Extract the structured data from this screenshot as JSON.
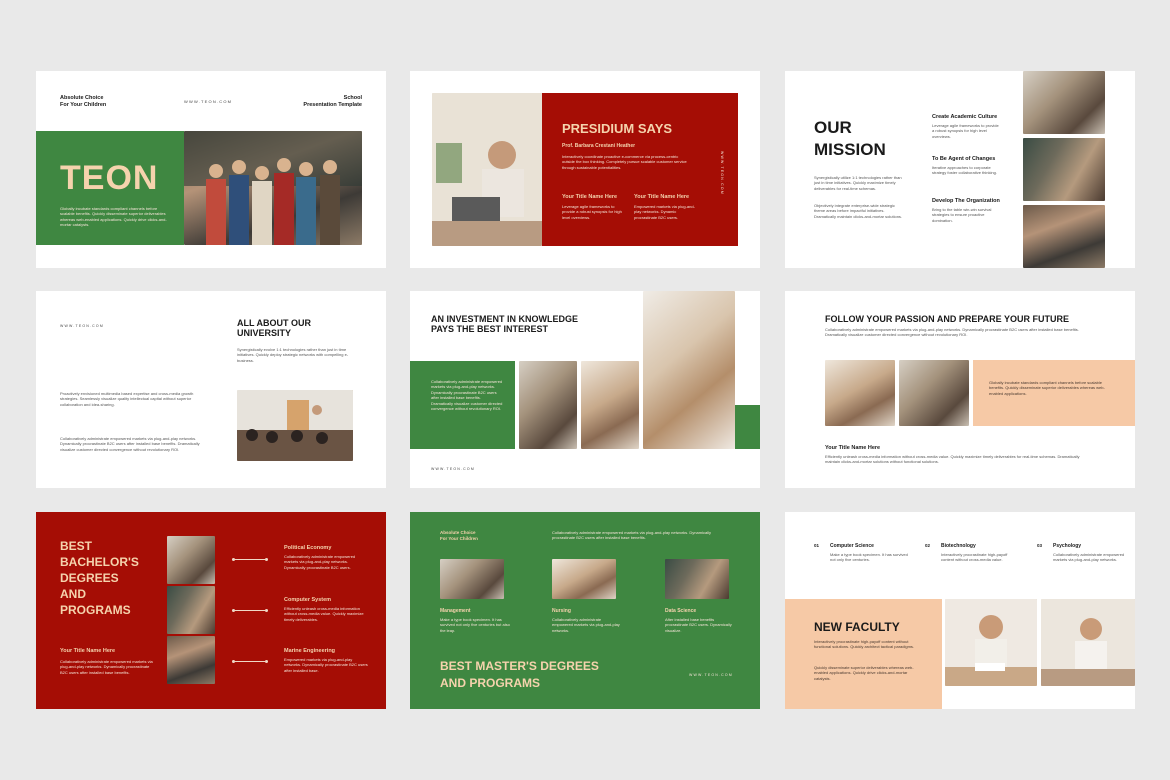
{
  "s1": {
    "top_left": [
      "Absolute Choice",
      "For Your Children"
    ],
    "web": "WWW.TEON.COM",
    "top_right": [
      "School",
      "Presentation Template"
    ],
    "title": "TEON",
    "desc": "Globally incubate standards compliant channels before scalable benefits. Quickly disseminate superior deliverables whereas web-enabled applications. Quickly drive clicks-and-mortar catalysts."
  },
  "s2": {
    "title": "PRESIDIUM SAYS",
    "author": "Prof. Barbara Crestani Heather",
    "quote": "Interactively coordinate proactive e-commerce via process-centric outside the box thinking. Completely pursue scalable customer service through sustainable potentialities.",
    "web_vertical": "WWW.TEON.COM",
    "col1_title": "Your Title Name Here",
    "col1_text": "Leverage agile frameworks to provide a robust synopsis for high level overviews.",
    "col2_title": "Your Title Name Here",
    "col2_text": "Empowered markets via plug-and-play networks. Dynamic procrastinate B2C users."
  },
  "s3": {
    "title": [
      "OUR",
      "MISSION"
    ],
    "p1": "Synergistically utilize 1:1 technologies rather than just in time initiatives. Quickly maximize timely deliverables for real-time schemas.",
    "p2": "Objectively integrate enterprise-wide strategic theme areas before impactful initiatives. Dramatically maintain clicks-and-mortar solutions.",
    "items": [
      {
        "title": "Create Academic Culture",
        "text": "Leverage agile frameworks to provide a robust synopsis for high level overviews."
      },
      {
        "title": "To Be Agent of Changes",
        "text": "Iterative approaches to corporate strategy foster collaborative thinking."
      },
      {
        "title": "Develop The Organization",
        "text": "Bring to the table win-win survival strategies to ensure proactive domination."
      }
    ]
  },
  "s4": {
    "web": "WWW.TEON.COM",
    "title": [
      "ALL ABOUT OUR",
      "UNIVERSITY"
    ],
    "p1": "Synergistically evolve 1:1 technologies rather than just in time initiatives. Quickly deploy strategic networks with compelling e-business.",
    "p2": "Proactively envisioned multimedia based expertise and cross-media growth strategies. Seamlessly visualize quality intellectual capital without superior collaboration and idea-sharing.",
    "p3": "Collaboratively administrate empowered markets via plug-and-play networks. Dynamically procrastinate B2C users after installed base benefits. Dramatically visualize customer directed convergence without revolutionary ROI."
  },
  "s5": {
    "title": [
      "AN INVESTMENT IN KNOWLEDGE",
      "PAYS THE BEST INTEREST"
    ],
    "text": "Collaboratively administrate empowered markets via plug-and-play networks. Dynamically procrastinate B2C users after installed base benefits. Dramatically visualize customer directed convergence without revolutionary ROI.",
    "web": "WWW.TEON.COM"
  },
  "s6": {
    "title": "FOLLOW YOUR PASSION AND PREPARE YOUR FUTURE",
    "intro": "Collaboratively administrate empowered markets via plug-and-play networks. Dynamically procrastinate B2C users after installed base benefits. Dramatically visualize customer directed convergence without revolutionary ROI.",
    "peach_text": "Globally incubate standards compliant channels before scalable benefits. Quickly disseminate superior deliverables whereas web-enabled applications.",
    "sub_title": "Your Title Name Here",
    "sub_text": "Efficiently unleash cross-media information without cross-media value. Quickly maximize timely deliverables for real-time schemas. Dramatically maintain clicks-and-mortar solutions without functional solutions."
  },
  "s7": {
    "title": [
      "BEST",
      "BACHELOR'S",
      "DEGREES",
      "AND",
      "PROGRAMS"
    ],
    "sub_title": "Your Title Name Here",
    "sub_text": "Collaboratively administrate empowered markets via plug-and-play networks. Dynamically procrastinate B2C users after installed base benefits.",
    "items": [
      {
        "title": "Political Economy",
        "text": "Collaboratively administrate empowered markets via plug-and-play networks. Dynamically procrastinate B2C users."
      },
      {
        "title": "Computer System",
        "text": "Efficiently unleash cross-media information without cross-media value. Quickly maximize timely deliverables."
      },
      {
        "title": "Marine Engineering",
        "text": "Empowered markets via plug-and-play networks. Dynamically procrastinate B2C users after installed base."
      }
    ]
  },
  "s8": {
    "top_left": [
      "Absolute Choice",
      "For Your Children"
    ],
    "top_text": "Collaboratively administrate empowered markets via plug-and-play networks. Dynamically procrastinate B2C users after installed base benefits.",
    "columns": [
      {
        "title": "Management",
        "text": "Make a type book specimen. It has survived not only five centuries but also the leap."
      },
      {
        "title": "Nursing",
        "text": "Collaboratively administrate empowered markets via plug-and-play networks."
      },
      {
        "title": "Data Science",
        "text": "After installed base benefits procrastinate B2C users. Dynamically visualize."
      }
    ],
    "title": [
      "BEST MASTER'S DEGREES",
      "AND PROGRAMS"
    ],
    "web": "WWW.TEON.COM"
  },
  "s9": {
    "items": [
      {
        "num": "01",
        "title": "Computer Science",
        "text": "Make a type book specimen. It has survived not only five centuries."
      },
      {
        "num": "02",
        "title": "Biotechnology",
        "text": "Interactively procrastinate high-payoff content without cross-media value."
      },
      {
        "num": "03",
        "title": "Psychology",
        "text": "Collaboratively administrate empowered markets via plug-and-play networks."
      }
    ],
    "title": "NEW FACULTY",
    "p1": "Interactively procrastinate high-payoff content without functional solutions. Quickly architect tactical paradigms.",
    "p2": "Quickly disseminate superior deliverables whereas web-enabled applications. Quickly drive clicks-and-mortar catalysts."
  },
  "colors": {
    "red": "#a50d05",
    "green": "#3f8741",
    "peach": "#f6c9a6",
    "cream": "#f3d6b4",
    "background": "#e9e9e9"
  }
}
